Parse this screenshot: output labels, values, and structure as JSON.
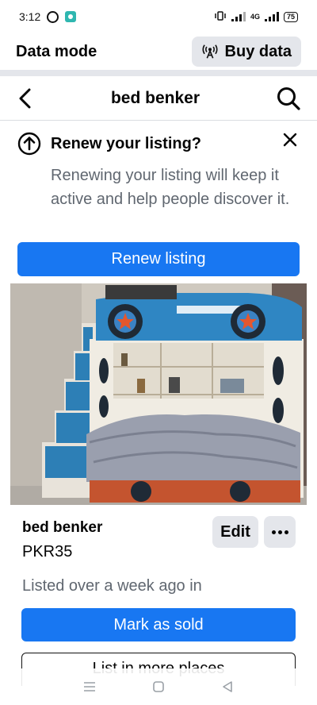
{
  "status_bar": {
    "time": "3:12",
    "battery": "75",
    "network": "4G"
  },
  "data_mode": {
    "title": "Data mode",
    "buy_data_label": "Buy data",
    "buy_data_icon": "antenna-icon"
  },
  "header": {
    "title": "bed benker",
    "back_icon": "chevron-left-icon",
    "search_icon": "search-icon"
  },
  "renew_banner": {
    "icon": "arrow-up-circle-icon",
    "title": "Renew your listing?",
    "description": "Renewing your listing will keep it active and help people discover it.",
    "button_label": "Renew listing",
    "close_icon": "close-icon"
  },
  "listing": {
    "image_subject": "bunk bed with staircase photo",
    "title": "bed benker",
    "price": "PKR35",
    "edit_label": "Edit",
    "listed_text": "Listed over a week ago in",
    "mark_sold_label": "Mark as sold",
    "list_more_label": "List in more places"
  },
  "colors": {
    "accent": "#1877f2",
    "secondary_button": "#e4e6eb",
    "muted_text": "#606770"
  }
}
